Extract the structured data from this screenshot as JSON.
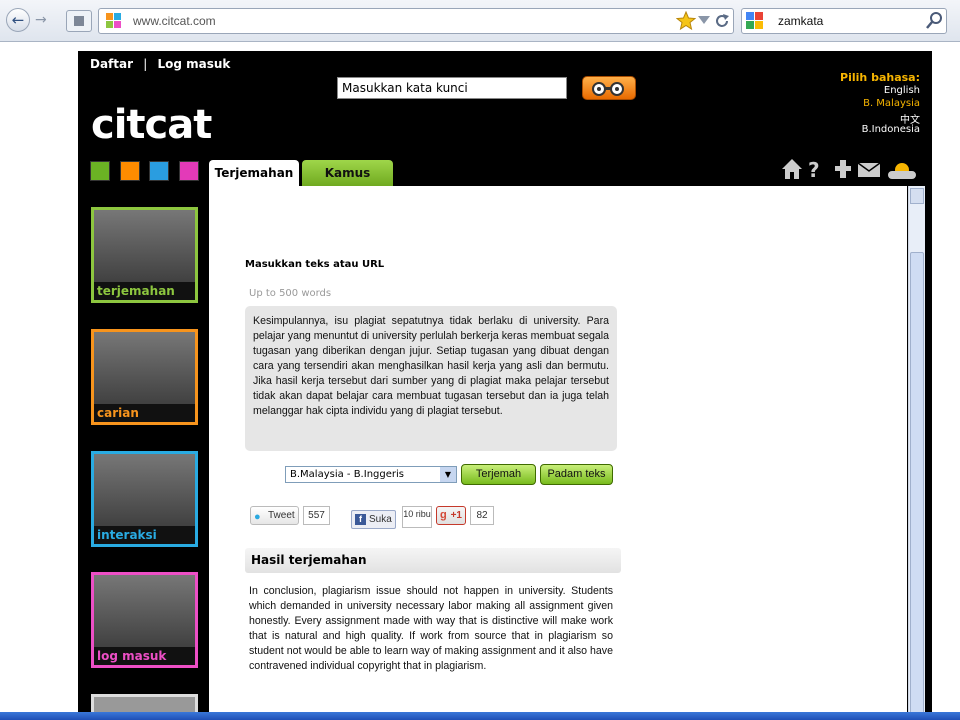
{
  "browser": {
    "url": "www.citcat.com",
    "search_value": "zamkata",
    "back_glyph": "←",
    "forward_glyph": "→"
  },
  "site": {
    "top_links": {
      "register": "Daftar",
      "sep": "|",
      "login": "Log masuk"
    },
    "keyword_placeholder": "Masukkan kata kunci",
    "logo": "citcat",
    "language": {
      "heading": "Pilih bahasa:",
      "options": [
        "English",
        "B. Malaysia",
        "中文",
        "B.Indonesia"
      ],
      "selected": "B. Malaysia"
    },
    "tabs": [
      "Terjemahan",
      "Kamus"
    ],
    "active_tab": "Terjemahan",
    "color_squares": [
      "#6bb324",
      "#ff8c00",
      "#2a9de0",
      "#e33ab8"
    ],
    "side_photos": [
      {
        "label": "terjemahan",
        "color": "#8dc63f"
      },
      {
        "label": "carian",
        "color": "#f7941d"
      },
      {
        "label": "interaksi",
        "color": "#29abe2"
      },
      {
        "label": "log masuk",
        "color": "#ed4fc6"
      }
    ]
  },
  "form": {
    "heading": "Masukkan teks atau URL",
    "hint": "Up to 500 words",
    "source_text": "Kesimpulannya, isu plagiat sepatutnya tidak berlaku di university. Para pelajar yang menuntut di university perlulah berkerja keras membuat segala tugasan yang diberikan dengan jujur. Setiap tugasan yang dibuat dengan cara yang tersendiri akan menghasilkan hasil kerja yang asli dan bermutu. Jika hasil kerja tersebut dari sumber yang di plagiat maka pelajar tersebut tidak akan dapat belajar cara membuat tugasan tersebut dan ia juga telah melanggar hak cipta individu yang di plagiat tersebut.",
    "direction": "B.Malaysia - B.Inggeris",
    "translate_button": "Terjemah",
    "clear_button": "Padam teks"
  },
  "social": {
    "tweet_label": "Tweet",
    "tweet_count": "557",
    "like_label": "Suka",
    "like_count": "10 ribu",
    "plusone_label": "+1",
    "plusone_count": "82"
  },
  "result": {
    "heading": "Hasil terjemahan",
    "text": "In conclusion, plagiarism issue should not happen in university. Students which demanded in university necessary labor making all assignment given honestly. Every assignment made with way that is distinctive will make work that is natural and high quality. If work from source that in plagiarism so student not would be able to learn way of making assignment and it also have contravened individual copyright that in plagiarism."
  }
}
